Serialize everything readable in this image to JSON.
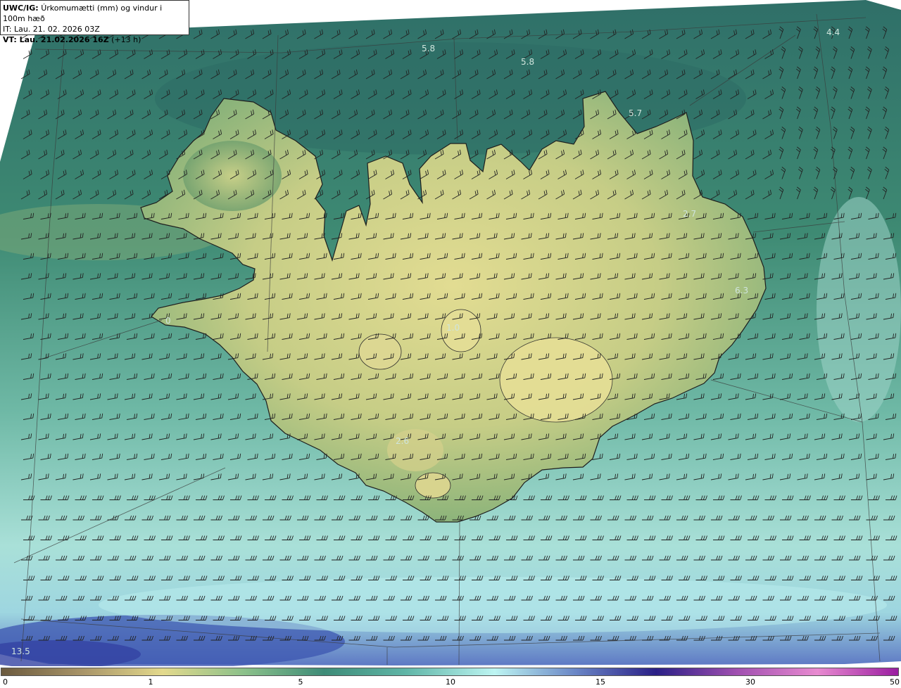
{
  "header": {
    "model": "UWC/IG:",
    "field": "Úrkomumætti (mm) og vindur i 100m hæð",
    "init_time": "IT: Lau. 21. 02. 2026 03Z",
    "valid_time": "VT: Lau. 21.02.2026 16Z",
    "lead": "(+13 h)"
  },
  "map": {
    "country": "Iceland",
    "value_labels": [
      "4.4",
      "5.8",
      "5.8",
      "5.7",
      "2.7",
      "6.3",
      "0",
      "1.0",
      "2.6",
      "13.5"
    ]
  },
  "colorbar": {
    "ticks": [
      "0",
      "1",
      "5",
      "10",
      "15",
      "30",
      "50"
    ],
    "colors": [
      "#6b5a3e",
      "#a89468",
      "#e3d98c",
      "#8cc18a",
      "#3e8c78",
      "#5fb5a6",
      "#bdf5f2",
      "#6a86c6",
      "#2a1f86",
      "#a04fb0",
      "#e88ad0",
      "#9a1da0"
    ]
  },
  "palette": {
    "deep_sea": "#2e6e68",
    "sea": "#3f8a76",
    "lowland": "#78a872",
    "highland": "#d9d68a",
    "south_sea": "#a9dcd0",
    "heavy": "#3a4aa8"
  }
}
